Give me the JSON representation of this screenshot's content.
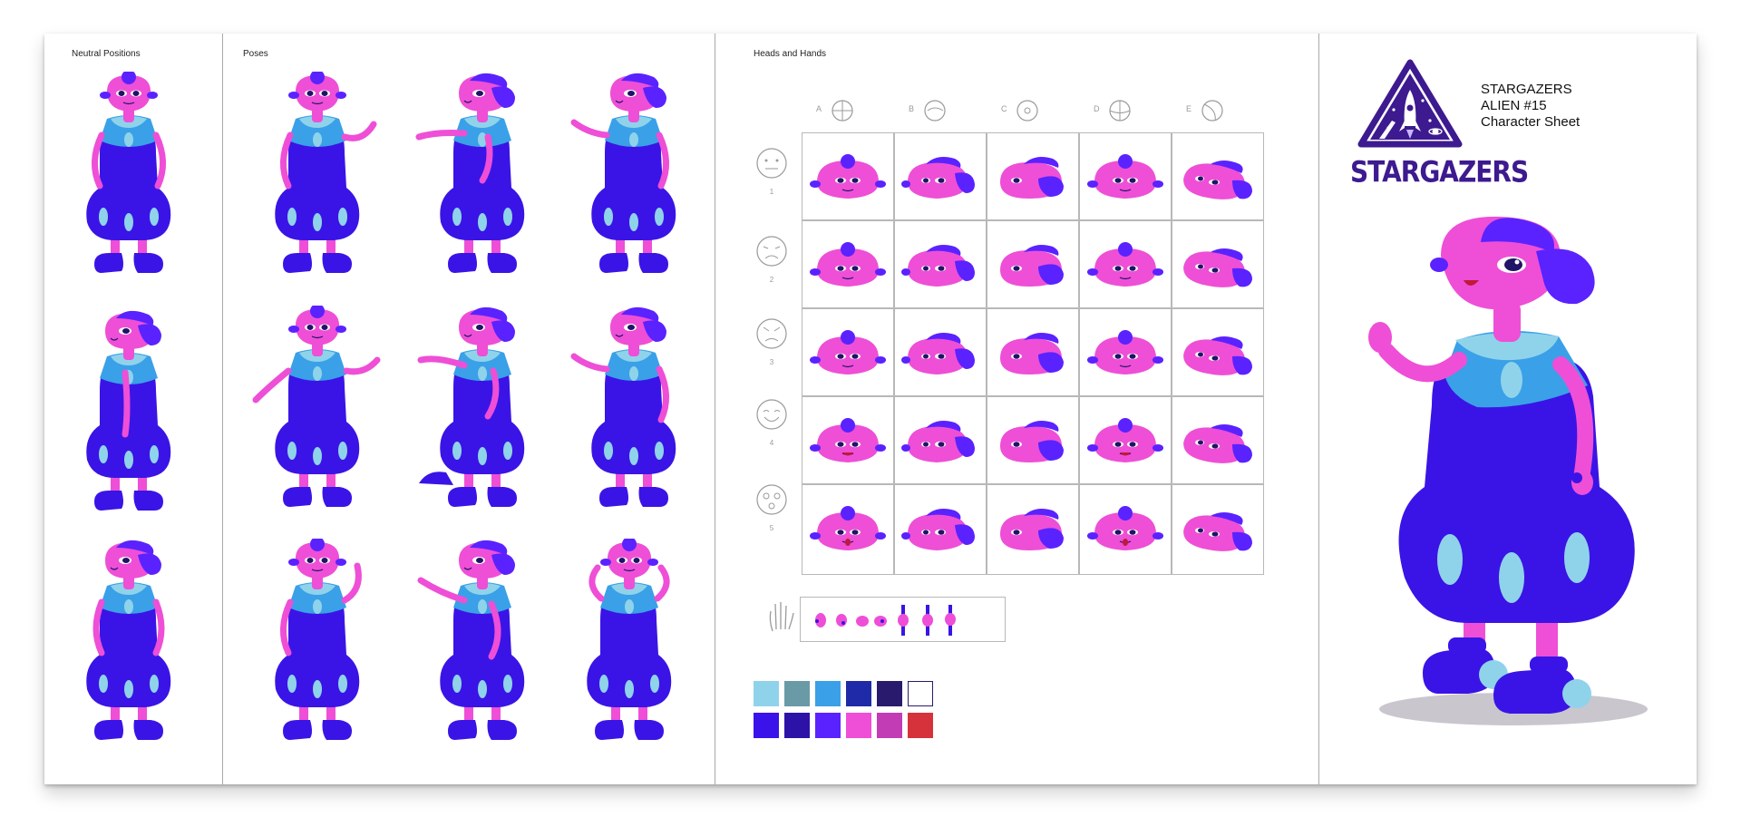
{
  "sections": {
    "neutral": "Neutral Positions",
    "poses": "Poses",
    "heads": "Heads and Hands"
  },
  "brand": {
    "logo_text": "STARGAZERS",
    "line1": "STARGAZERS",
    "line2": "ALIEN #15",
    "line3": "Character Sheet"
  },
  "head_columns": [
    "A",
    "B",
    "C",
    "D",
    "E"
  ],
  "head_rows": [
    "1",
    "2",
    "3",
    "4",
    "5"
  ],
  "palette": {
    "row1": [
      "#8fd3eb",
      "#6a9aa6",
      "#3aa0e8",
      "#1f2aa8",
      "#2a1a6e",
      "#ffffff"
    ],
    "row2": [
      "#3a12ea",
      "#2d12a8",
      "#5a22ff",
      "#ee4fd6",
      "#c23cb6",
      "#d6323c"
    ]
  },
  "colors": {
    "skin": "#ee4fd6",
    "dress": "#3a14e6",
    "collar": "#8fd3eb",
    "top": "#3aa0e8",
    "hat": "#5a22ff",
    "dark": "#1f1466"
  }
}
